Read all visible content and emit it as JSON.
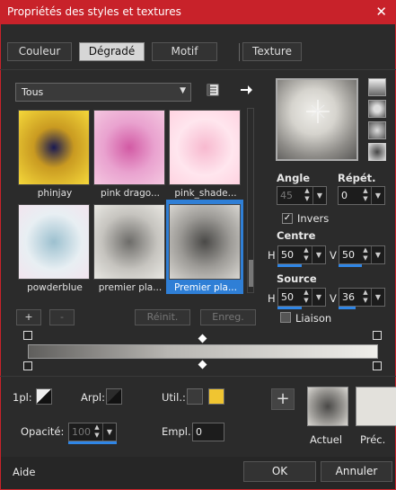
{
  "window": {
    "title": "Propriétés des styles et textures",
    "close_glyph": "✕"
  },
  "tabs": [
    {
      "label": "Couleur",
      "selected": false
    },
    {
      "label": "Dégradé",
      "selected": true
    },
    {
      "label": "Motif",
      "selected": false
    },
    {
      "label": "Texture",
      "selected": false
    }
  ],
  "category_select": {
    "value": "Tous"
  },
  "icons": {
    "library": "library-icon",
    "arrow": "right-arrow-icon"
  },
  "gallery": [
    {
      "label": "phinjay",
      "colors": [
        "#1a1a52",
        "#c99a21",
        "#f5d83a"
      ]
    },
    {
      "label": "pink drago...",
      "colors": [
        "#d25aa4",
        "#e9a2cf",
        "#f4c7e0"
      ]
    },
    {
      "label": "pink_shade...",
      "colors": [
        "#f7b9cf",
        "#ffe6ee",
        "#ffd3e1"
      ]
    },
    {
      "label": "powderblue",
      "colors": [
        "#9cc0cf",
        "#e8eff3",
        "#f2e4ee"
      ]
    },
    {
      "label": "premier pla...",
      "colors": [
        "#6d6c69",
        "#c6c4bf",
        "#e8e7e2"
      ]
    },
    {
      "label": "Premier pla...",
      "colors": [
        "#4a4947",
        "#9c9a96",
        "#d8d6d1"
      ],
      "selected": true
    }
  ],
  "gallery_buttons": {
    "add": "+",
    "remove": "-",
    "reset": "Réinit.",
    "save": "Enreg."
  },
  "angle": {
    "label": "Angle",
    "value": "45"
  },
  "repeat": {
    "label": "Répét.",
    "value": "0"
  },
  "invert": {
    "label": "Invers",
    "checked": true
  },
  "centre": {
    "label": "Centre",
    "h_label": "H",
    "h_value": "50",
    "v_label": "V",
    "v_value": "50"
  },
  "source": {
    "label": "Source",
    "h_label": "H",
    "h_value": "50",
    "v_label": "V",
    "v_value": "36"
  },
  "link": {
    "label": "Liaison",
    "checked": false
  },
  "editor": {
    "pl_label": "1pl:",
    "arpl_label": "Arpl:",
    "util_label": "Util.:",
    "util_colors": [
      "#3a3a3a",
      "#f0c531"
    ],
    "opacity_label": "Opacité:",
    "opacity_value": "100",
    "empl_label": "Empl.:",
    "empl_value": "0"
  },
  "compare": {
    "add": "+",
    "current_label": "Actuel",
    "previous_label": "Préc."
  },
  "bottom": {
    "help": "Aide",
    "ok": "OK",
    "cancel": "Annuler"
  }
}
